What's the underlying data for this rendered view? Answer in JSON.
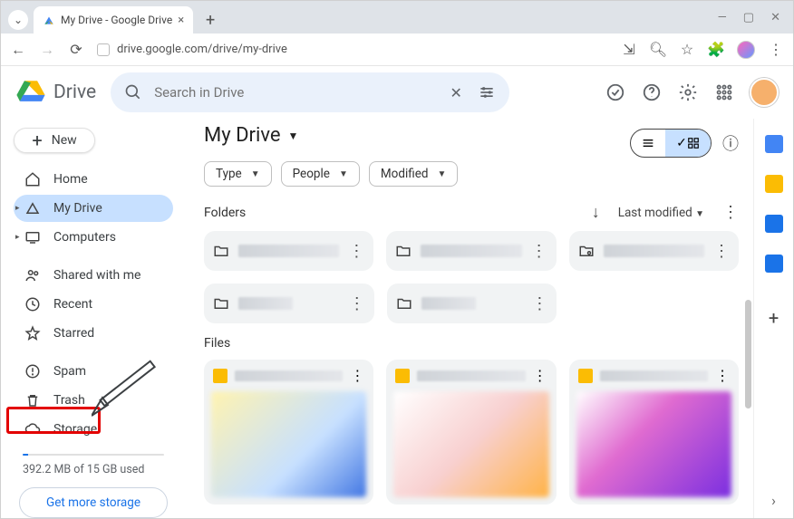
{
  "browser": {
    "tab_title": "My Drive - Google Drive",
    "url": "drive.google.com/drive/my-drive"
  },
  "app": {
    "product_name": "Drive",
    "search_placeholder": "Search in Drive"
  },
  "sidebar": {
    "new_label": "New",
    "items": [
      {
        "label": "Home"
      },
      {
        "label": "My Drive"
      },
      {
        "label": "Computers"
      },
      {
        "label": "Shared with me"
      },
      {
        "label": "Recent"
      },
      {
        "label": "Starred"
      },
      {
        "label": "Spam"
      },
      {
        "label": "Trash"
      },
      {
        "label": "Storage"
      }
    ],
    "storage_text": "392.2 MB of 15 GB used",
    "get_storage_label": "Get more storage"
  },
  "main": {
    "title": "My Drive",
    "filters": [
      {
        "label": "Type"
      },
      {
        "label": "People"
      },
      {
        "label": "Modified"
      }
    ],
    "sections": {
      "folders_label": "Folders",
      "files_label": "Files"
    },
    "sort": {
      "label": "Last modified"
    }
  },
  "highlight_target": "Trash"
}
